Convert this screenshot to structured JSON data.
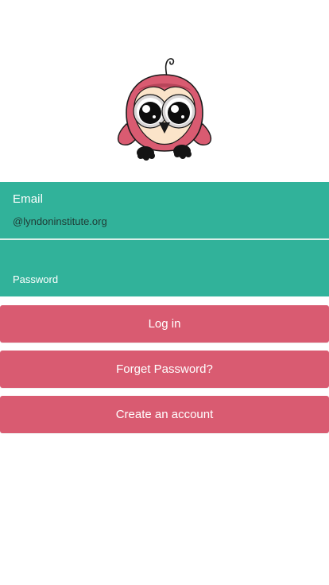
{
  "logo": {
    "icon": "owl-mascot-icon"
  },
  "email": {
    "label": "Email",
    "value": "@lyndoninstitute.org"
  },
  "password": {
    "placeholder": "Password"
  },
  "buttons": {
    "login_label": "Log in",
    "forgot_label": "Forget Password?",
    "create_label": "Create an account"
  },
  "colors": {
    "field_background": "#31b29a",
    "button_background": "#d95b71",
    "page_background": "#ffffff"
  }
}
